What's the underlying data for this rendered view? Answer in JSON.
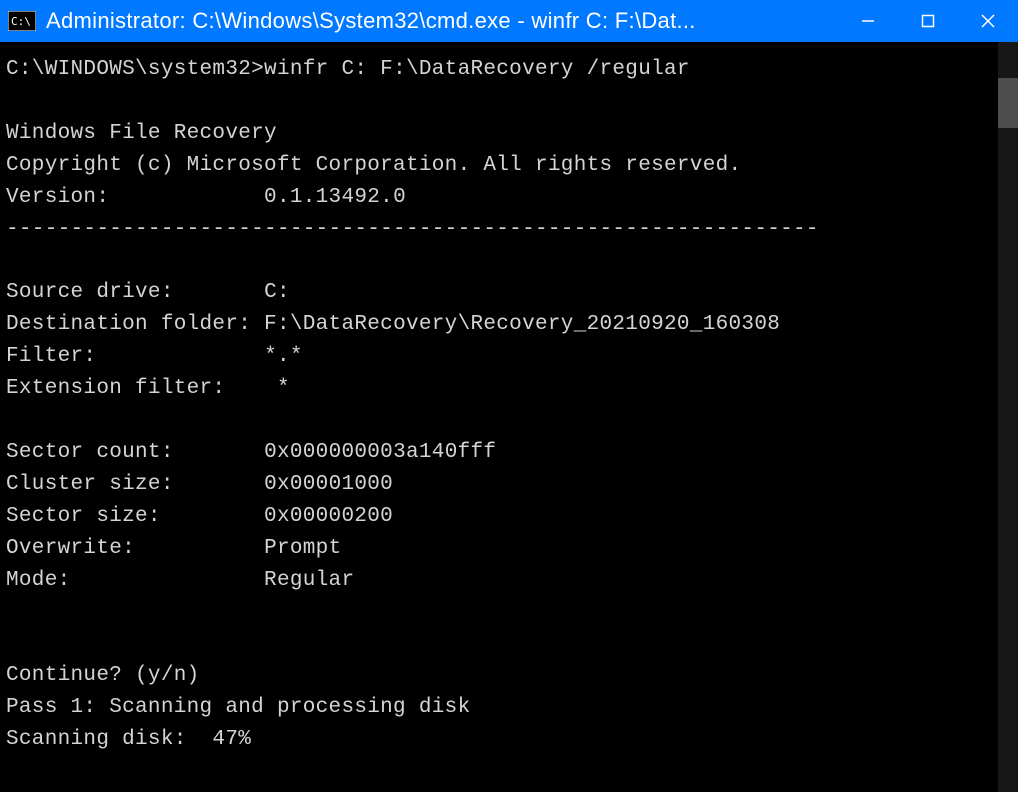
{
  "titlebar": {
    "title": "Administrator: C:\\Windows\\System32\\cmd.exe - winfr  C: F:\\Dat..."
  },
  "terminal": {
    "prompt": "C:\\WINDOWS\\system32>",
    "command": "winfr C: F:\\DataRecovery /regular",
    "app_name": "Windows File Recovery",
    "copyright": "Copyright (c) Microsoft Corporation. All rights reserved.",
    "version_label": "Version:",
    "version_value": "0.1.13492.0",
    "separator": "---------------------------------------------------------------",
    "fields": {
      "source_drive_label": "Source drive:",
      "source_drive_value": "C:",
      "destination_label": "Destination folder:",
      "destination_value": "F:\\DataRecovery\\Recovery_20210920_160308",
      "filter_label": "Filter:",
      "filter_value": "*.*",
      "ext_filter_label": "Extension filter:",
      "ext_filter_value": "*",
      "sector_count_label": "Sector count:",
      "sector_count_value": "0x000000003a140fff",
      "cluster_size_label": "Cluster size:",
      "cluster_size_value": "0x00001000",
      "sector_size_label": "Sector size:",
      "sector_size_value": "0x00000200",
      "overwrite_label": "Overwrite:",
      "overwrite_value": "Prompt",
      "mode_label": "Mode:",
      "mode_value": "Regular"
    },
    "continue_prompt": "Continue? (y/n)",
    "pass_line": "Pass 1: Scanning and processing disk",
    "scanning_line": "Scanning disk:  47%"
  }
}
